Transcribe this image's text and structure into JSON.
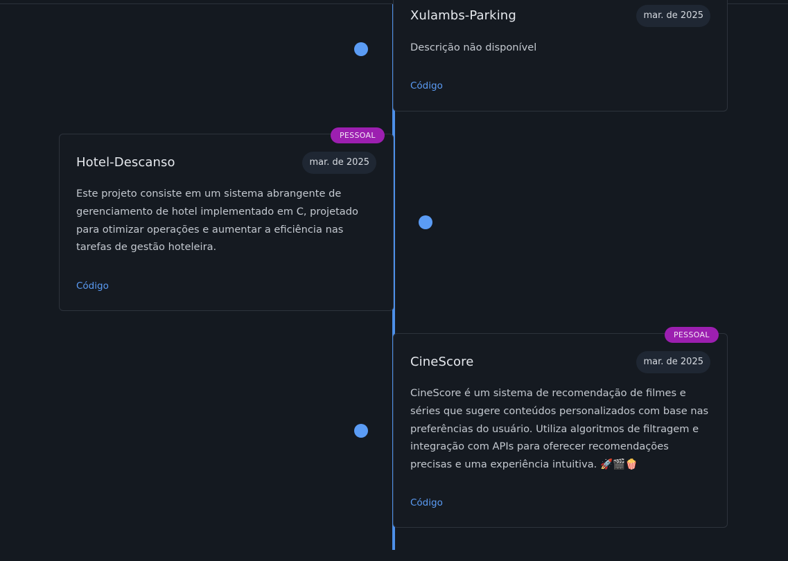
{
  "timeline": {
    "items": [
      {
        "title": "Xulambs-Parking",
        "date": "mar. de 2025",
        "description": "Descrição não disponível",
        "link_label": "Código"
      },
      {
        "title": "Hotel-Descanso",
        "date": "mar. de 2025",
        "badge": "PESSOAL",
        "description": "Este projeto consiste em um sistema abrangente de gerenciamento de hotel implementado em C, projetado para otimizar operações e aumentar a eficiência nas tarefas de gestão hoteleira.",
        "link_label": "Código"
      },
      {
        "title": "CineScore",
        "date": "mar. de 2025",
        "badge": "PESSOAL",
        "description": "CineScore é um sistema de recomendação de filmes e séries que sugere conteúdos personalizados com base nas preferências do usuário. Utiliza algoritmos de filtragem e integração com APIs para oferecer recomendações precisas e uma experiência intuitiva. 🚀🎬🍿",
        "link_label": "Código"
      }
    ]
  },
  "colors": {
    "background": "#141920",
    "accent": "#5b9cf5",
    "badge": "#9c1fb0"
  }
}
